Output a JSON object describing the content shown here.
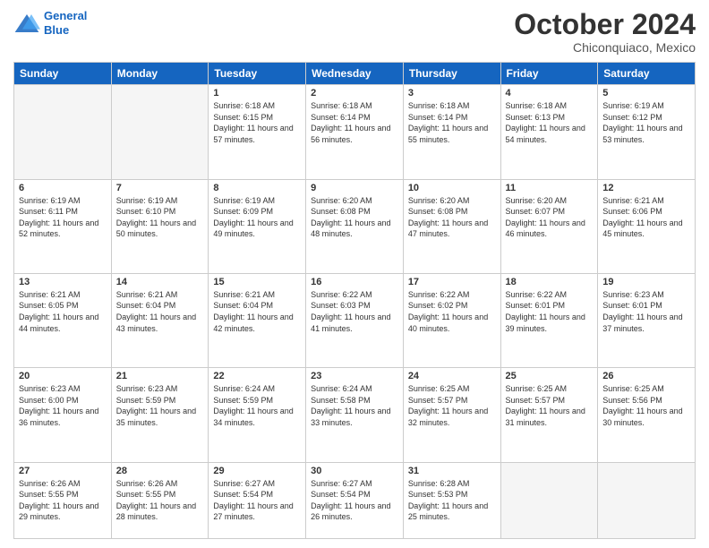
{
  "header": {
    "logo_line1": "General",
    "logo_line2": "Blue",
    "month": "October 2024",
    "location": "Chiconquiaco, Mexico"
  },
  "weekdays": [
    "Sunday",
    "Monday",
    "Tuesday",
    "Wednesday",
    "Thursday",
    "Friday",
    "Saturday"
  ],
  "weeks": [
    [
      {
        "day": "",
        "empty": true
      },
      {
        "day": "",
        "empty": true
      },
      {
        "day": "1",
        "sunrise": "6:18 AM",
        "sunset": "6:15 PM",
        "daylight": "11 hours and 57 minutes."
      },
      {
        "day": "2",
        "sunrise": "6:18 AM",
        "sunset": "6:14 PM",
        "daylight": "11 hours and 56 minutes."
      },
      {
        "day": "3",
        "sunrise": "6:18 AM",
        "sunset": "6:14 PM",
        "daylight": "11 hours and 55 minutes."
      },
      {
        "day": "4",
        "sunrise": "6:18 AM",
        "sunset": "6:13 PM",
        "daylight": "11 hours and 54 minutes."
      },
      {
        "day": "5",
        "sunrise": "6:19 AM",
        "sunset": "6:12 PM",
        "daylight": "11 hours and 53 minutes."
      }
    ],
    [
      {
        "day": "6",
        "sunrise": "6:19 AM",
        "sunset": "6:11 PM",
        "daylight": "11 hours and 52 minutes."
      },
      {
        "day": "7",
        "sunrise": "6:19 AM",
        "sunset": "6:10 PM",
        "daylight": "11 hours and 50 minutes."
      },
      {
        "day": "8",
        "sunrise": "6:19 AM",
        "sunset": "6:09 PM",
        "daylight": "11 hours and 49 minutes."
      },
      {
        "day": "9",
        "sunrise": "6:20 AM",
        "sunset": "6:08 PM",
        "daylight": "11 hours and 48 minutes."
      },
      {
        "day": "10",
        "sunrise": "6:20 AM",
        "sunset": "6:08 PM",
        "daylight": "11 hours and 47 minutes."
      },
      {
        "day": "11",
        "sunrise": "6:20 AM",
        "sunset": "6:07 PM",
        "daylight": "11 hours and 46 minutes."
      },
      {
        "day": "12",
        "sunrise": "6:21 AM",
        "sunset": "6:06 PM",
        "daylight": "11 hours and 45 minutes."
      }
    ],
    [
      {
        "day": "13",
        "sunrise": "6:21 AM",
        "sunset": "6:05 PM",
        "daylight": "11 hours and 44 minutes."
      },
      {
        "day": "14",
        "sunrise": "6:21 AM",
        "sunset": "6:04 PM",
        "daylight": "11 hours and 43 minutes."
      },
      {
        "day": "15",
        "sunrise": "6:21 AM",
        "sunset": "6:04 PM",
        "daylight": "11 hours and 42 minutes."
      },
      {
        "day": "16",
        "sunrise": "6:22 AM",
        "sunset": "6:03 PM",
        "daylight": "11 hours and 41 minutes."
      },
      {
        "day": "17",
        "sunrise": "6:22 AM",
        "sunset": "6:02 PM",
        "daylight": "11 hours and 40 minutes."
      },
      {
        "day": "18",
        "sunrise": "6:22 AM",
        "sunset": "6:01 PM",
        "daylight": "11 hours and 39 minutes."
      },
      {
        "day": "19",
        "sunrise": "6:23 AM",
        "sunset": "6:01 PM",
        "daylight": "11 hours and 37 minutes."
      }
    ],
    [
      {
        "day": "20",
        "sunrise": "6:23 AM",
        "sunset": "6:00 PM",
        "daylight": "11 hours and 36 minutes."
      },
      {
        "day": "21",
        "sunrise": "6:23 AM",
        "sunset": "5:59 PM",
        "daylight": "11 hours and 35 minutes."
      },
      {
        "day": "22",
        "sunrise": "6:24 AM",
        "sunset": "5:59 PM",
        "daylight": "11 hours and 34 minutes."
      },
      {
        "day": "23",
        "sunrise": "6:24 AM",
        "sunset": "5:58 PM",
        "daylight": "11 hours and 33 minutes."
      },
      {
        "day": "24",
        "sunrise": "6:25 AM",
        "sunset": "5:57 PM",
        "daylight": "11 hours and 32 minutes."
      },
      {
        "day": "25",
        "sunrise": "6:25 AM",
        "sunset": "5:57 PM",
        "daylight": "11 hours and 31 minutes."
      },
      {
        "day": "26",
        "sunrise": "6:25 AM",
        "sunset": "5:56 PM",
        "daylight": "11 hours and 30 minutes."
      }
    ],
    [
      {
        "day": "27",
        "sunrise": "6:26 AM",
        "sunset": "5:55 PM",
        "daylight": "11 hours and 29 minutes."
      },
      {
        "day": "28",
        "sunrise": "6:26 AM",
        "sunset": "5:55 PM",
        "daylight": "11 hours and 28 minutes."
      },
      {
        "day": "29",
        "sunrise": "6:27 AM",
        "sunset": "5:54 PM",
        "daylight": "11 hours and 27 minutes."
      },
      {
        "day": "30",
        "sunrise": "6:27 AM",
        "sunset": "5:54 PM",
        "daylight": "11 hours and 26 minutes."
      },
      {
        "day": "31",
        "sunrise": "6:28 AM",
        "sunset": "5:53 PM",
        "daylight": "11 hours and 25 minutes."
      },
      {
        "day": "",
        "empty": true
      },
      {
        "day": "",
        "empty": true
      }
    ]
  ],
  "labels": {
    "sunrise": "Sunrise:",
    "sunset": "Sunset:",
    "daylight": "Daylight:"
  }
}
